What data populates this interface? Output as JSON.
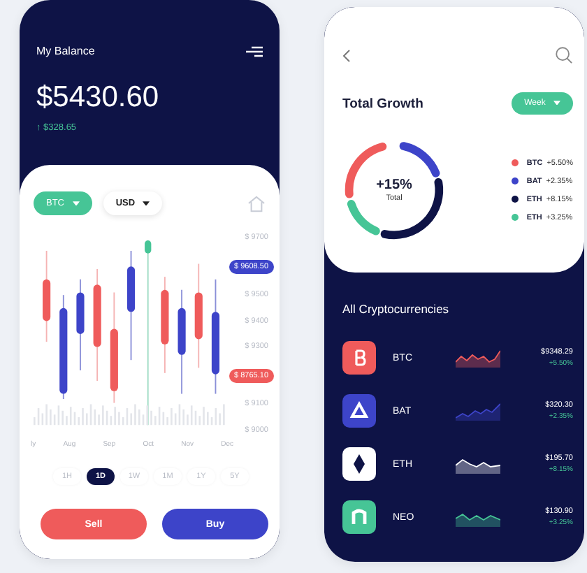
{
  "balance_screen": {
    "title": "My Balance",
    "balance": "$5430.60",
    "change": "↑ $328.65",
    "pair": {
      "coin": "BTC",
      "currency": "USD"
    },
    "price_scale": [
      {
        "kind": "tick",
        "text": "$ 9700"
      },
      {
        "kind": "badge",
        "text": "$ 9608.50",
        "color": "#3d44c9"
      },
      {
        "kind": "tick",
        "text": "$ 9500"
      },
      {
        "kind": "tick",
        "text": "$ 9400"
      },
      {
        "kind": "tick",
        "text": "$ 9300"
      },
      {
        "kind": "badge",
        "text": "$ 8765.10",
        "color": "#ef5b5b"
      },
      {
        "kind": "tick",
        "text": "$ 9100"
      },
      {
        "kind": "tick",
        "text": "$ 9000"
      }
    ],
    "months": [
      "ly",
      "Aug",
      "Sep",
      "Oct",
      "Nov",
      "Dec"
    ],
    "timeframes": [
      {
        "label": "1H",
        "selected": false
      },
      {
        "label": "1D",
        "selected": true
      },
      {
        "label": "1W",
        "selected": false
      },
      {
        "label": "1M",
        "selected": false
      },
      {
        "label": "1Y",
        "selected": false
      },
      {
        "label": "5Y",
        "selected": false
      }
    ],
    "actions": [
      {
        "kind": "sell",
        "label": "Sell"
      },
      {
        "kind": "buy",
        "label": "Buy"
      }
    ]
  },
  "growth_screen": {
    "title": "Total Growth",
    "period": "Week",
    "total": "+15%",
    "total_label": "Total",
    "legend": [
      {
        "coin": "BTC",
        "change": "+5.50%",
        "color": "#ef5b5b"
      },
      {
        "coin": "BAT",
        "change": "+2.35%",
        "color": "#3d44c9"
      },
      {
        "coin": "ETH",
        "change": "+8.15%",
        "color": "#0e1346"
      },
      {
        "coin": "ETH",
        "change": "+3.25%",
        "color": "#46c596"
      }
    ],
    "list_title": "All Cryptocurrencies",
    "coins": [
      {
        "symbol": "BTC",
        "price": "$9348.29",
        "change": "+5.50%",
        "color": "#ef5b5b"
      },
      {
        "symbol": "BAT",
        "price": "$320.30",
        "change": "+2.35%",
        "color": "#3d44c9"
      },
      {
        "symbol": "ETH",
        "price": "$195.70",
        "change": "+8.15%",
        "color": "#ffffff"
      },
      {
        "symbol": "NEO",
        "price": "$130.90",
        "change": "+3.25%",
        "color": "#46c596"
      }
    ]
  }
}
